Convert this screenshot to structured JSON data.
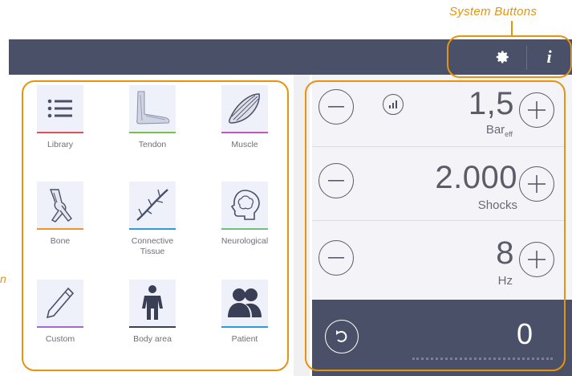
{
  "annotations": {
    "system_buttons": "System Buttons",
    "left_callout_fragment": "n"
  },
  "topbar": {
    "settings_icon": "gear-icon",
    "info_icon": "info-icon",
    "info_glyph": "i"
  },
  "menu": {
    "items": [
      {
        "label": "Library",
        "icon": "list-icon",
        "accent": "#E0525A"
      },
      {
        "label": "Tendon",
        "icon": "tendon-icon",
        "accent": "#7CC04B"
      },
      {
        "label": "Muscle",
        "icon": "muscle-icon",
        "accent": "#C457B9"
      },
      {
        "label": "Bone",
        "icon": "bone-icon",
        "accent": "#F0932B"
      },
      {
        "label": "Connective Tissue",
        "icon": "connective-tissue-icon",
        "accent": "#2D9CDB"
      },
      {
        "label": "Neurological",
        "icon": "brain-icon",
        "accent": "#6DC080"
      },
      {
        "label": "Custom",
        "icon": "pencil-icon",
        "accent": "#A06BD0"
      },
      {
        "label": "Body area",
        "icon": "body-icon",
        "accent": "#3A3F55"
      },
      {
        "label": "Patient",
        "icon": "patients-icon",
        "accent": "#2D9CDB"
      }
    ]
  },
  "params": {
    "pressure": {
      "value": "1,5",
      "unit": "Bar",
      "unit_sub": "eff"
    },
    "shocks": {
      "value": "2.000",
      "unit": "Shocks"
    },
    "frequency": {
      "value": "8",
      "unit": "Hz"
    }
  },
  "bottom": {
    "counter": "0",
    "reset_icon": "reset-icon"
  },
  "colors": {
    "accent_orange": "#E8930C",
    "bar_bg": "#4A5068"
  }
}
